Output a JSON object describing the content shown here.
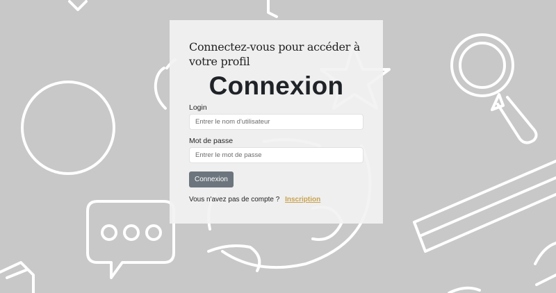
{
  "login": {
    "subtitle": "Connectez-vous pour accéder à votre profil",
    "title": "Connexion",
    "username": {
      "label": "Login",
      "placeholder": "Entrer le nom d'utilisateur",
      "value": ""
    },
    "password": {
      "label": "Mot de passe",
      "placeholder": "Entrer le mot de passe",
      "value": ""
    },
    "submit_label": "Connexion",
    "signup_prompt": "Vous n'avez pas de compte ?",
    "signup_link": "Inscription"
  },
  "colors": {
    "background": "#c8c8c8",
    "card": "#f2f2f2",
    "button": "#6c757d",
    "link": "#c9a24d",
    "doodle_stroke": "#ffffff"
  },
  "icons": [
    "magnifier-icon",
    "speech-bubble-icon",
    "globe-icon",
    "star-icon",
    "apple-icon",
    "circle-icon",
    "pencil-icon",
    "book-icon"
  ]
}
